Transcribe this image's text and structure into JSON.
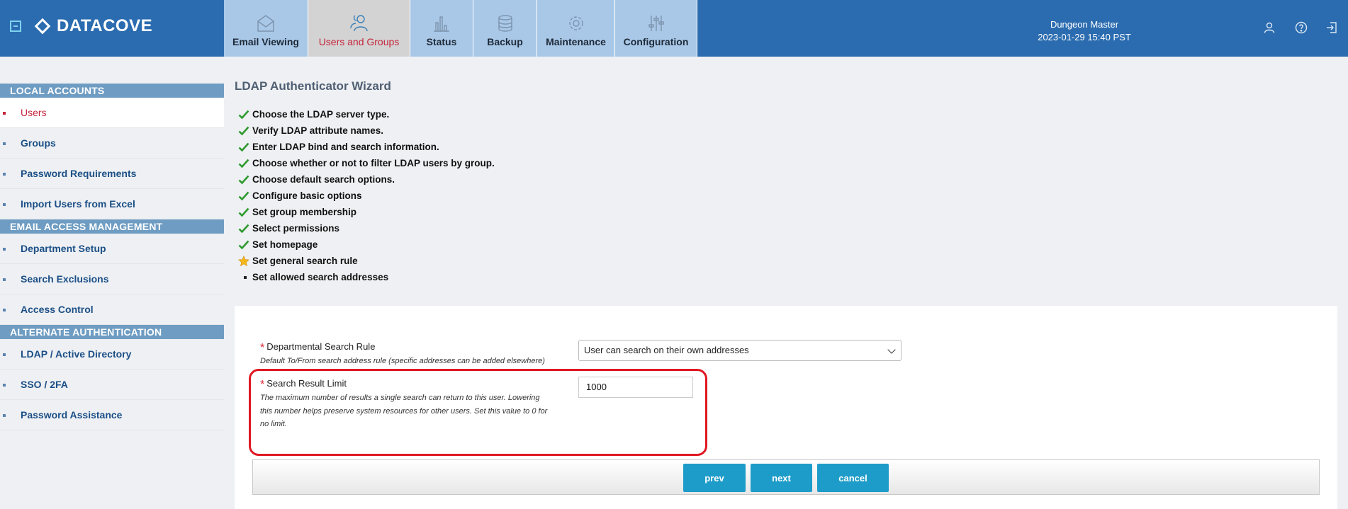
{
  "header": {
    "brand": "DATACOVE",
    "tabs": [
      {
        "label": "Email Viewing",
        "icon": "envelope-icon"
      },
      {
        "label": "Users and Groups",
        "icon": "users-icon"
      },
      {
        "label": "Status",
        "icon": "bar-chart-icon"
      },
      {
        "label": "Backup",
        "icon": "database-icon"
      },
      {
        "label": "Maintenance",
        "icon": "gear-icon"
      },
      {
        "label": "Configuration",
        "icon": "sliders-icon"
      }
    ],
    "user_name": "Dungeon Master",
    "datetime": "2023-01-29 15:40 PST",
    "icons": [
      "user-icon",
      "help-icon",
      "logout-icon"
    ]
  },
  "sidebar": {
    "sections": [
      {
        "title": "LOCAL ACCOUNTS",
        "items": [
          "Users",
          "Groups",
          "Password Requirements",
          "Import Users from Excel"
        ]
      },
      {
        "title": "EMAIL ACCESS MANAGEMENT",
        "items": [
          "Department Setup",
          "Search Exclusions",
          "Access Control"
        ]
      },
      {
        "title": "ALTERNATE AUTHENTICATION",
        "items": [
          "LDAP / Active Directory",
          "SSO / 2FA",
          "Password Assistance"
        ]
      }
    ],
    "active_item": "Users"
  },
  "wizard": {
    "title": "LDAP Authenticator Wizard",
    "steps": [
      {
        "label": "Choose the LDAP server type.",
        "status": "done"
      },
      {
        "label": "Verify LDAP attribute names.",
        "status": "done"
      },
      {
        "label": "Enter LDAP bind and search information.",
        "status": "done"
      },
      {
        "label": "Choose whether or not to filter LDAP users by group.",
        "status": "done"
      },
      {
        "label": "Choose default search options.",
        "status": "done"
      },
      {
        "label": "Configure basic options",
        "status": "done"
      },
      {
        "label": "Set group membership",
        "status": "done"
      },
      {
        "label": "Select permissions",
        "status": "done"
      },
      {
        "label": "Set homepage",
        "status": "done"
      },
      {
        "label": "Set general search rule",
        "status": "current"
      },
      {
        "label": "Set allowed search addresses",
        "status": "pending"
      }
    ]
  },
  "form": {
    "rule_label": "Departmental Search Rule",
    "rule_help": "Default To/From search address rule (specific addresses can be added elsewhere)",
    "rule_value": "User can search on their own addresses",
    "limit_label": "Search Result Limit",
    "limit_help_lines": [
      "The maximum number of results a single search can return to this user. Lowering",
      "this number helps preserve system resources for other users. Set this value to 0 for",
      "no limit."
    ],
    "limit_value": "1000",
    "required_mark": "*"
  },
  "buttons": {
    "prev": "prev",
    "next": "next",
    "cancel": "cancel"
  },
  "colors": {
    "header": "#2b6cb0",
    "accent_red": "#c5243b",
    "button": "#1e9cc9",
    "section": "#6e9cc2"
  }
}
